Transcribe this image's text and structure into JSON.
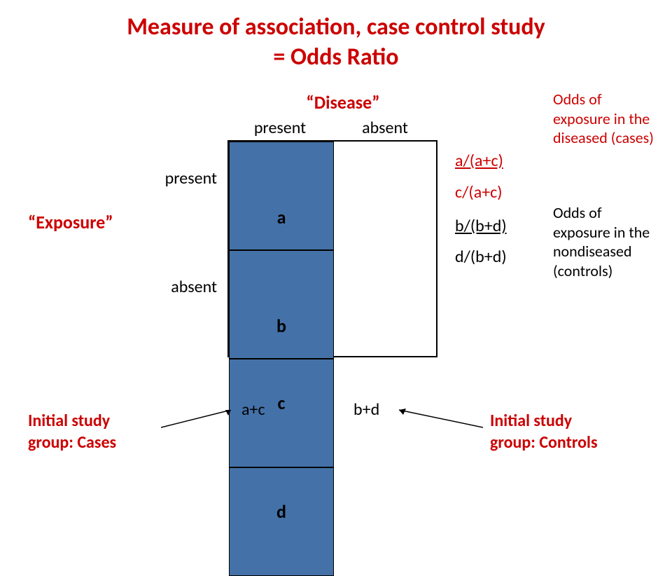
{
  "title_line1": "Measure of association, case control study",
  "title_line2": "= Odds Ratio",
  "disease_header": "“Disease”",
  "exposure_header": "“Exposure”",
  "columns": {
    "present": "present",
    "absent": "absent"
  },
  "rows": {
    "present": "present",
    "absent": "absent"
  },
  "cells": {
    "a": "a",
    "b": "b",
    "c": "c",
    "d": "d"
  },
  "sums": {
    "ac": "a+c",
    "bd": "b+d"
  },
  "cases_label_line1": "Initial study",
  "cases_label_line2": "group: Cases",
  "controls_label_line1": "Initial study",
  "controls_label_line2": "group: Controls",
  "odds_exposed_cases_num": "a/(a+c)",
  "odds_exposed_cases_den": "c/(a+c)",
  "odds_exposed_controls_num": "b/(b+d)",
  "odds_exposed_controls_den": "d/(b+d)",
  "odds_cases_text": "Odds of exposure in the diseased (cases)",
  "odds_controls_text": "Odds of exposure in the nondiseased (controls)",
  "chart_data": {
    "type": "table",
    "title": "2x2 Contingency Table for Case-Control Study (Odds Ratio)",
    "row_variable": "Exposure",
    "column_variable": "Disease",
    "row_categories": [
      "present",
      "absent"
    ],
    "column_categories": [
      "present",
      "absent"
    ],
    "cells": [
      [
        "a",
        "b"
      ],
      [
        "c",
        "d"
      ]
    ],
    "column_totals": [
      "a+c",
      "b+d"
    ],
    "odds_exposure_cases": "[a/(a+c)] / [c/(a+c)]",
    "odds_exposure_controls": "[b/(b+d)] / [d/(b+d)]",
    "initial_group_cases": "a+c",
    "initial_group_controls": "b+d"
  }
}
